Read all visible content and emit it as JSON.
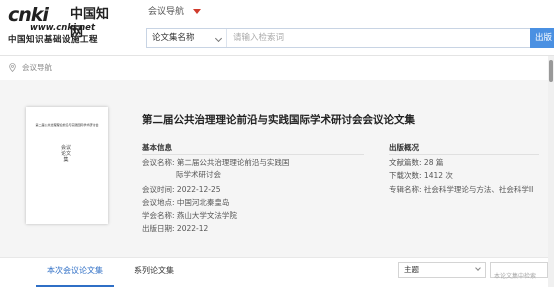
{
  "header": {
    "logo_main": "cnki",
    "logo_cn": "中国知网",
    "logo_url": "www.cnki.net",
    "logo_sub": "中国知识基础设施工程",
    "nav_title": "会议导航",
    "accent_color": "#d03b2c"
  },
  "search": {
    "field": "论文集名称",
    "placeholder": "请输入检索词",
    "button": "出版"
  },
  "breadcrumb": {
    "icon": "location-pin-icon",
    "text": "会议导航"
  },
  "book": {
    "title": "第二届公共治理理论前沿与实践国际学术研讨会会议论文集",
    "cover_title": "第二届公共治理理论前沿与实践国际学术研讨会",
    "cover_subtitle": "会议论文集"
  },
  "basic_info": {
    "heading": "基本信息",
    "rows": [
      {
        "label": "会议名称:",
        "value": "第二届公共治理理论前沿与实践国"
      },
      {
        "label": "",
        "value": "际学术研讨会"
      },
      {
        "label": "会议时间:",
        "value": "2022-12-25"
      },
      {
        "label": "会议地点:",
        "value": "中国河北秦皇岛"
      },
      {
        "label": "学会名称:",
        "value": "燕山大学文法学院"
      },
      {
        "label": "出版日期:",
        "value": "2022-12"
      }
    ]
  },
  "publish_info": {
    "heading": "出版概况",
    "rows": [
      {
        "label": "文献篇数:",
        "value": "28 篇"
      },
      {
        "label": "下载次数:",
        "value": "1412 次"
      },
      {
        "label": "专辑名称:",
        "value": "社会科学理论与方法、社会科学II"
      }
    ]
  },
  "tabs": [
    {
      "label": "本次会议论文集",
      "active": true
    },
    {
      "label": "系列论文集",
      "active": false
    }
  ],
  "sort": {
    "selected": "主题"
  },
  "inner_search": {
    "placeholder": "本论文集中检索"
  }
}
